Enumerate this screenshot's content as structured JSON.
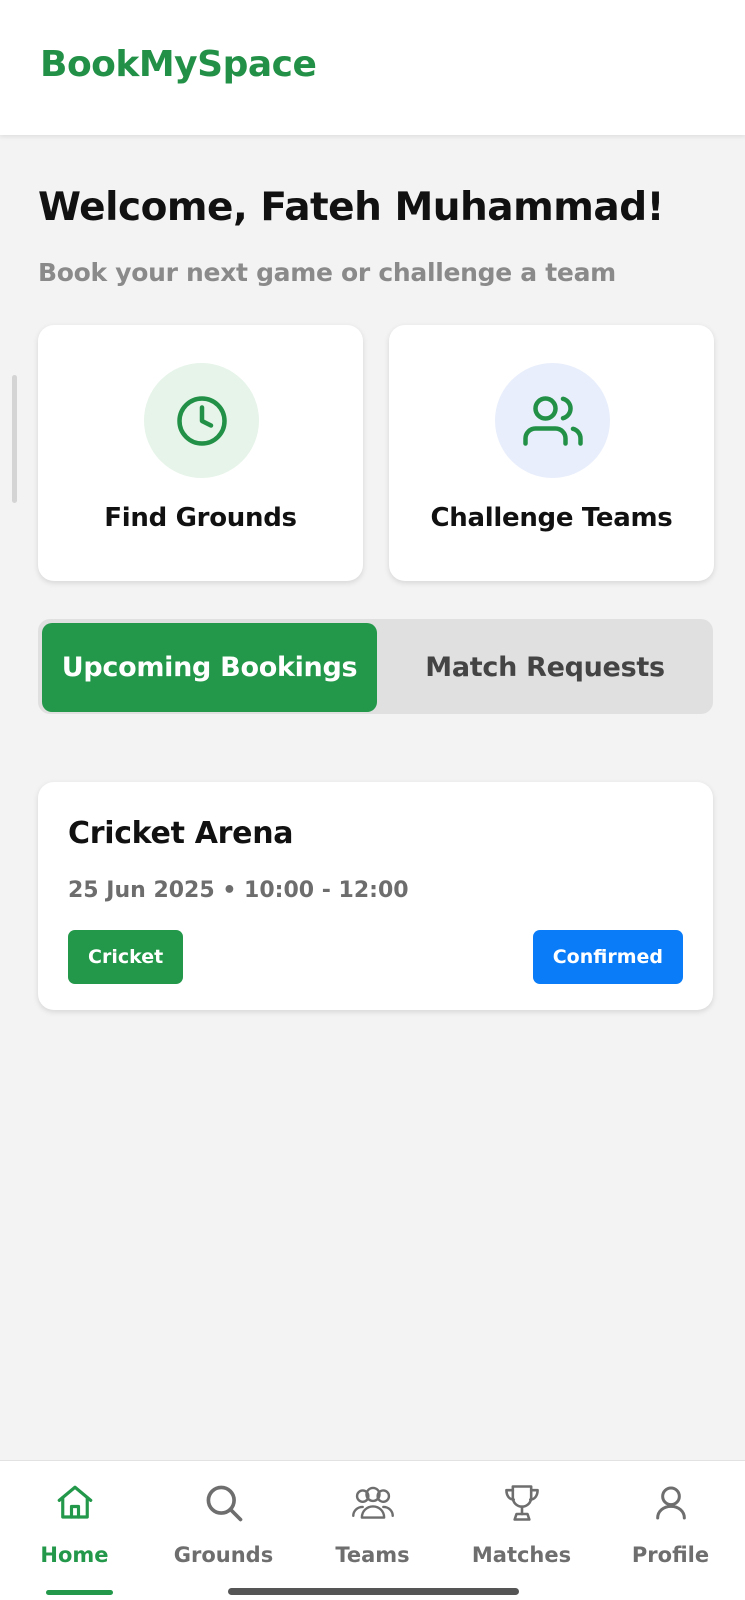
{
  "app": {
    "brand": "BookMySpace",
    "brand_color": "#229147"
  },
  "welcome": {
    "title": "Welcome, Fateh Muhammad!",
    "subtitle": "Book your next game or challenge a team"
  },
  "actions": [
    {
      "label": "Find Grounds",
      "icon": "clock-icon"
    },
    {
      "label": "Challenge Teams",
      "icon": "users-icon"
    }
  ],
  "tabs": {
    "active": "Upcoming Bookings",
    "inactive": "Match Requests"
  },
  "booking": {
    "venue": "Cricket Arena",
    "datetime": "25 Jun 2025 • 10:00 - 12:00",
    "sport": "Cricket",
    "status": "Confirmed",
    "status_color": "#0a7cf7"
  },
  "nav": [
    {
      "label": "Home",
      "icon": "home-icon",
      "active": true
    },
    {
      "label": "Grounds",
      "icon": "search-icon",
      "active": false
    },
    {
      "label": "Teams",
      "icon": "team-icon",
      "active": false
    },
    {
      "label": "Matches",
      "icon": "trophy-icon",
      "active": false
    },
    {
      "label": "Profile",
      "icon": "user-icon",
      "active": false
    }
  ]
}
